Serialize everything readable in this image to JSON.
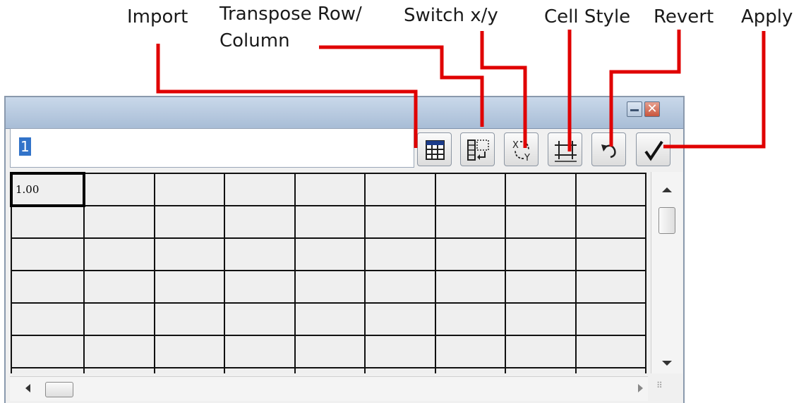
{
  "callouts": {
    "import": "Import",
    "transpose_line1": "Transpose Row/",
    "transpose_line2": "Column",
    "switch_xy": "Switch x/y",
    "cell_style": "Cell Style",
    "revert": "Revert",
    "apply": "Apply"
  },
  "window": {
    "minimize_glyph": "",
    "close_glyph": "✕"
  },
  "editor": {
    "value": "1"
  },
  "toolbar": [
    {
      "name": "import-button",
      "icon": "table-import-icon"
    },
    {
      "name": "transpose-button",
      "icon": "transpose-icon"
    },
    {
      "name": "switch-xy-button",
      "icon": "switch-xy-icon"
    },
    {
      "name": "cell-style-button",
      "icon": "cell-style-icon"
    },
    {
      "name": "revert-button",
      "icon": "undo-arrow-icon"
    },
    {
      "name": "apply-button",
      "icon": "checkmark-icon"
    }
  ],
  "grid": {
    "first_cell": "1.00"
  },
  "colors": {
    "leader_line": "#e00000",
    "selection": "#3273c9"
  }
}
